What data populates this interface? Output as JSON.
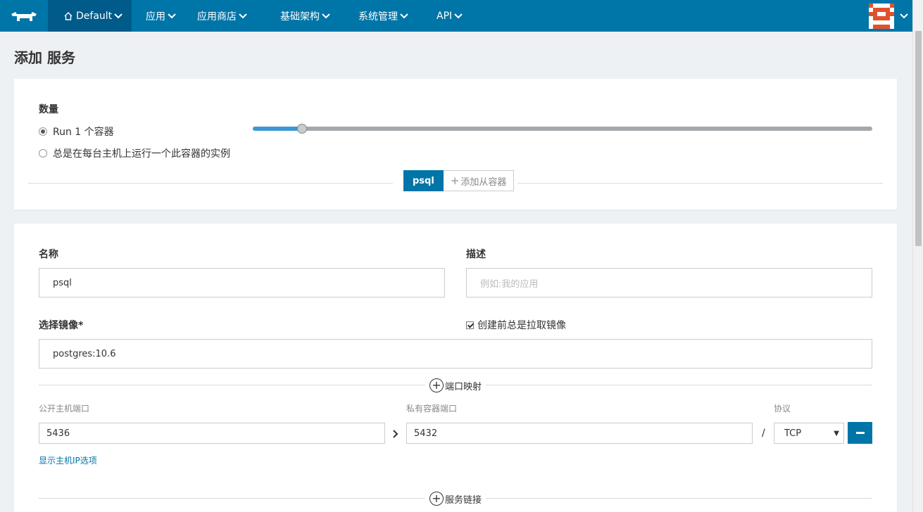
{
  "nav": {
    "env_label": "Default",
    "items": [
      {
        "label": "应用"
      },
      {
        "label": "应用商店"
      },
      {
        "label": "基础架构"
      },
      {
        "label": "系统管理"
      },
      {
        "label": "API"
      }
    ]
  },
  "page": {
    "title": "添加 服务"
  },
  "scale": {
    "label": "数量",
    "option_run": "Run 1 个容器",
    "option_always": "总是在每台主机上运行一个此容器的实例",
    "slider_fraction": 0.08
  },
  "tabs": {
    "active": "psql",
    "add": "添加从容器"
  },
  "form": {
    "name_label": "名称",
    "name_value": "psql",
    "desc_label": "描述",
    "desc_placeholder": "例如:我的应用",
    "image_label": "选择镜像*",
    "image_value": "postgres:10.6",
    "pull_label": "创建前总是拉取镜像"
  },
  "ports": {
    "section_label": "端口映射",
    "public_label": "公开主机端口",
    "private_label": "私有容器端口",
    "protocol_label": "协议",
    "public_value": "5436",
    "private_value": "5432",
    "separator": "/",
    "protocol_value": "TCP",
    "show_ip_link": "显示主机IP选项"
  },
  "links": {
    "section_label": "服务链接"
  },
  "colors": {
    "primary": "#0075a8",
    "nav_dark": "#005b8a",
    "slider_fill": "#3d98d3"
  }
}
